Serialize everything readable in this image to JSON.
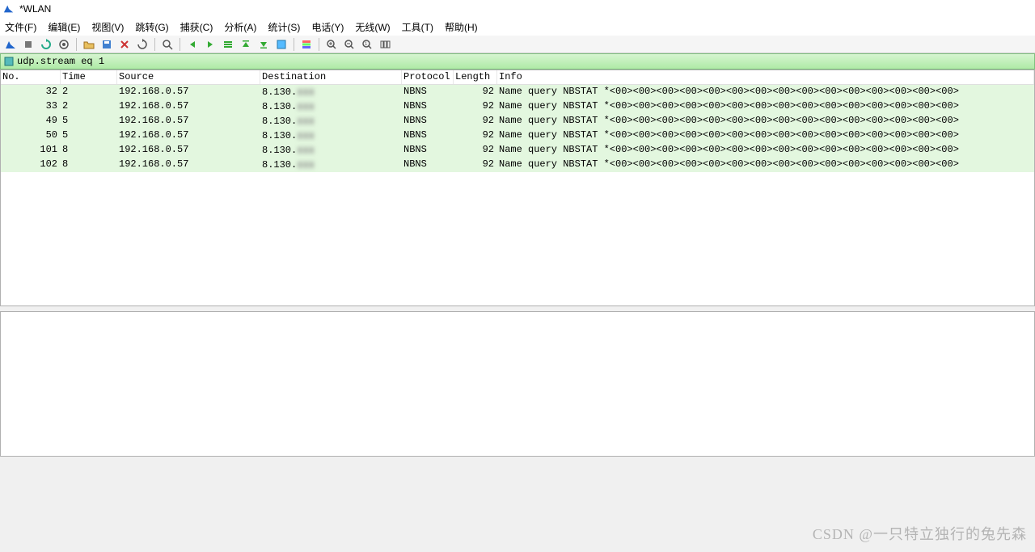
{
  "title": "*WLAN",
  "menu": [
    "文件(F)",
    "编辑(E)",
    "视图(V)",
    "跳转(G)",
    "捕获(C)",
    "分析(A)",
    "统计(S)",
    "电话(Y)",
    "无线(W)",
    "工具(T)",
    "帮助(H)"
  ],
  "filter": {
    "value": "udp.stream eq 1",
    "placeholder": ""
  },
  "columns": {
    "no": "No.",
    "time": "Time",
    "source": "Source",
    "destination": "Destination",
    "protocol": "Protocol",
    "length": "Length",
    "info": "Info"
  },
  "packets": [
    {
      "no": "32",
      "time": "2",
      "source": "192.168.0.57",
      "dest_prefix": "8.130",
      "dest_blur": "▮▮▮",
      "protocol": "NBNS",
      "length": "92",
      "info": "Name query NBSTAT *<00><00><00><00><00><00><00><00><00><00><00><00><00><00><00>"
    },
    {
      "no": "33",
      "time": "2",
      "source": "192.168.0.57",
      "dest_prefix": "8.130",
      "dest_blur": "▮▮▮",
      "protocol": "NBNS",
      "length": "92",
      "info": "Name query NBSTAT *<00><00><00><00><00><00><00><00><00><00><00><00><00><00><00>"
    },
    {
      "no": "49",
      "time": "5",
      "source": "192.168.0.57",
      "dest_prefix": "8.130",
      "dest_blur": "▮▮▮",
      "protocol": "NBNS",
      "length": "92",
      "info": "Name query NBSTAT *<00><00><00><00><00><00><00><00><00><00><00><00><00><00><00>"
    },
    {
      "no": "50",
      "time": "5",
      "source": "192.168.0.57",
      "dest_prefix": "8.130",
      "dest_blur": "▮▮▮",
      "protocol": "NBNS",
      "length": "92",
      "info": "Name query NBSTAT *<00><00><00><00><00><00><00><00><00><00><00><00><00><00><00>"
    },
    {
      "no": "101",
      "time": "8",
      "source": "192.168.0.57",
      "dest_prefix": "8.130",
      "dest_blur": "▮▮▮",
      "protocol": "NBNS",
      "length": "92",
      "info": "Name query NBSTAT *<00><00><00><00><00><00><00><00><00><00><00><00><00><00><00>"
    },
    {
      "no": "102",
      "time": "8",
      "source": "192.168.0.57",
      "dest_prefix": "8.130",
      "dest_blur": "▮▮▮",
      "protocol": "NBNS",
      "length": "92",
      "info": "Name query NBSTAT *<00><00><00><00><00><00><00><00><00><00><00><00><00><00><00>"
    }
  ],
  "toolbar_icons": [
    "shark",
    "stop",
    "restart",
    "options",
    "|",
    "open",
    "save",
    "close",
    "reload",
    "|",
    "find",
    "|",
    "back",
    "forward",
    "jump-to",
    "top",
    "bottom",
    "autoscroll",
    "|",
    "colorize",
    "|",
    "zoom-in",
    "zoom-out",
    "zoom-reset",
    "resize-cols"
  ],
  "watermark": "CSDN @一只特立独行的兔先森"
}
